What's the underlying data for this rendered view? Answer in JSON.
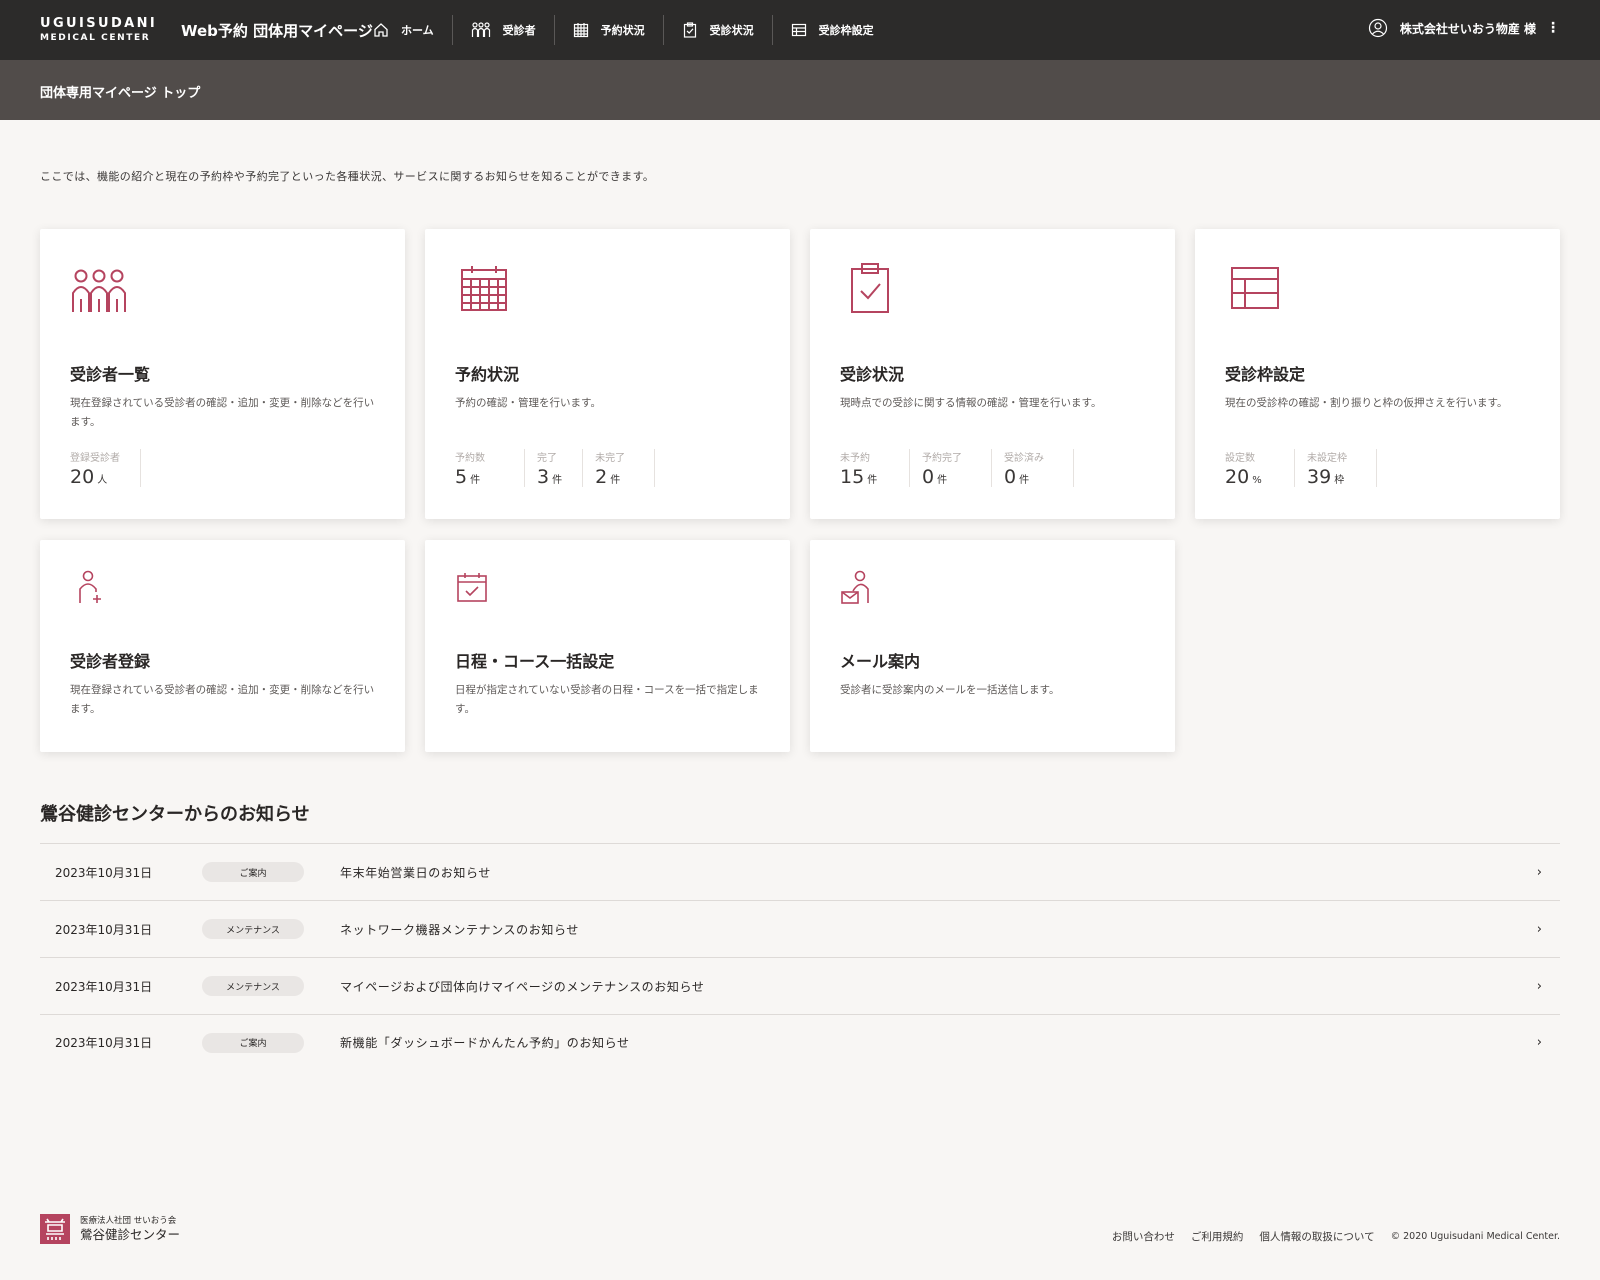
{
  "header": {
    "logo_line1": "UGUISUDANI",
    "logo_line2": "MEDICAL CENTER",
    "app_title": "Web予約 団体用マイページ",
    "nav": [
      {
        "label": "ホーム",
        "icon": "home-icon"
      },
      {
        "label": "受診者",
        "icon": "people-icon"
      },
      {
        "label": "予約状況",
        "icon": "calendar-icon"
      },
      {
        "label": "受診状況",
        "icon": "clipboard-check-icon"
      },
      {
        "label": "受診枠設定",
        "icon": "table-icon"
      }
    ],
    "user_name": "株式会社せいおう物産 様",
    "menu_glyph": "⋮"
  },
  "subheader": {
    "title": "団体専用マイページ トップ"
  },
  "intro": "ここでは、機能の紹介と現在の予約枠や予約完了といった各種状況、サービスに関するお知らせを知ることができます。",
  "cards": [
    {
      "title": "受診者一覧",
      "desc": "現在登録されている受診者の確認・追加・変更・削除などを行います。",
      "icon": "people-icon",
      "stats": [
        {
          "label": "登録受診者",
          "value": "20",
          "unit": "人"
        }
      ]
    },
    {
      "title": "予約状況",
      "desc": "予約の確認・管理を行います。",
      "icon": "calendar-icon",
      "stats": [
        {
          "label": "予約数",
          "value": "5",
          "unit": "件"
        },
        {
          "label": "完了",
          "value": "3",
          "unit": "件"
        },
        {
          "label": "未完了",
          "value": "2",
          "unit": "件"
        }
      ]
    },
    {
      "title": "受診状況",
      "desc": "現時点での受診に関する情報の確認・管理を行います。",
      "icon": "clipboard-check-icon",
      "stats": [
        {
          "label": "未予約",
          "value": "15",
          "unit": "件"
        },
        {
          "label": "予約完了",
          "value": "0",
          "unit": "件"
        },
        {
          "label": "受診済み",
          "value": "0",
          "unit": "件"
        }
      ]
    },
    {
      "title": "受診枠設定",
      "desc": "現在の受診枠の確認・割り振りと枠の仮押さえを行います。",
      "icon": "table-icon",
      "stats": [
        {
          "label": "設定数",
          "value": "20",
          "unit": "%"
        },
        {
          "label": "未設定枠",
          "value": "39",
          "unit": "枠"
        }
      ]
    },
    {
      "title": "受診者登録",
      "desc": "現在登録されている受診者の確認・追加・変更・削除などを行います。",
      "icon": "person-add-icon"
    },
    {
      "title": "日程・コース一括設定",
      "desc": "日程が指定されていない受診者の日程・コースを一括で指定します。",
      "icon": "calendar-check-icon"
    },
    {
      "title": "メール案内",
      "desc": "受診者に受診案内のメールを一括送信します。",
      "icon": "person-mail-icon"
    }
  ],
  "news": {
    "title": "鶯谷健診センターからのお知らせ",
    "items": [
      {
        "date": "2023年10月31日",
        "badge": "ご案内",
        "text": "年末年始営業日のお知らせ"
      },
      {
        "date": "2023年10月31日",
        "badge": "メンテナンス",
        "text": "ネットワーク機器メンテナンスのお知らせ"
      },
      {
        "date": "2023年10月31日",
        "badge": "メンテナンス",
        "text": "マイページおよび団体向けマイページのメンテナンスのお知らせ"
      },
      {
        "date": "2023年10月31日",
        "badge": "ご案内",
        "text": "新機能「ダッシュボードかんたん予約」のお知らせ"
      }
    ],
    "chevron": "›"
  },
  "footer": {
    "org_line1": "医療法人社団 せいおう会",
    "org_line2": "鶯谷健診センター",
    "links": [
      "お問い合わせ",
      "ご利用規約",
      "個人情報の取扱について"
    ],
    "copyright": "© 2020 Uguisudani Medical Center."
  },
  "colors": {
    "accent": "#b5445f",
    "header_bg": "#2c2b2a",
    "subheader_bg": "#514c4a",
    "page_bg": "#f8f6f4"
  }
}
